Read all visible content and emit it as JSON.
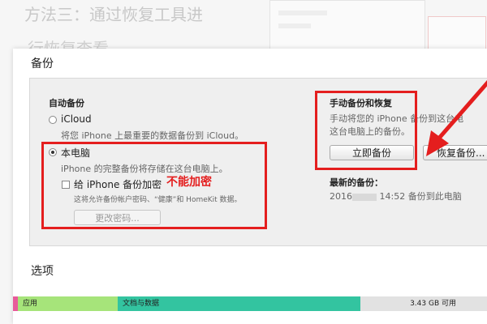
{
  "background": {
    "heading": "方法三：通过恢复工具进",
    "subheading": "行恢复查看"
  },
  "backup": {
    "section_title": "备份",
    "auto": {
      "title": "自动备份",
      "icloud_label": "iCloud",
      "icloud_desc": "将您 iPhone 上最重要的数据备份到 iCloud。",
      "this_computer_label": "本电脑",
      "this_computer_desc": "iPhone 的完整备份将存储在这台电脑上。",
      "encrypt_label": "给 iPhone 备份加密",
      "encrypt_desc": "这将允许备份帐户密码、“健康”和 HomeKit 数据。",
      "change_password": "更改密码...",
      "annotation": "不能加密"
    },
    "manual": {
      "title": "手动备份和恢复",
      "desc_line1": "手动将您的 iPhone 备份到这台电",
      "desc_line2": "这台电脑上的备份。",
      "backup_now": "立即备份",
      "restore": "恢复备份..."
    },
    "latest": {
      "title": "最新的备份：",
      "year": "2016",
      "text": "14:52 备份到此电脑"
    }
  },
  "options": {
    "section_title": "选项"
  },
  "storage": {
    "apps_label": "应用",
    "docs_label": "文档与数据",
    "free_label": "3.43 GB 可用"
  },
  "colors": {
    "annotation_red": "#e41e1e",
    "apps": "#a6e47a",
    "docs": "#33c4a0",
    "other": "#e85a9a",
    "free": "#e2e2e2"
  }
}
